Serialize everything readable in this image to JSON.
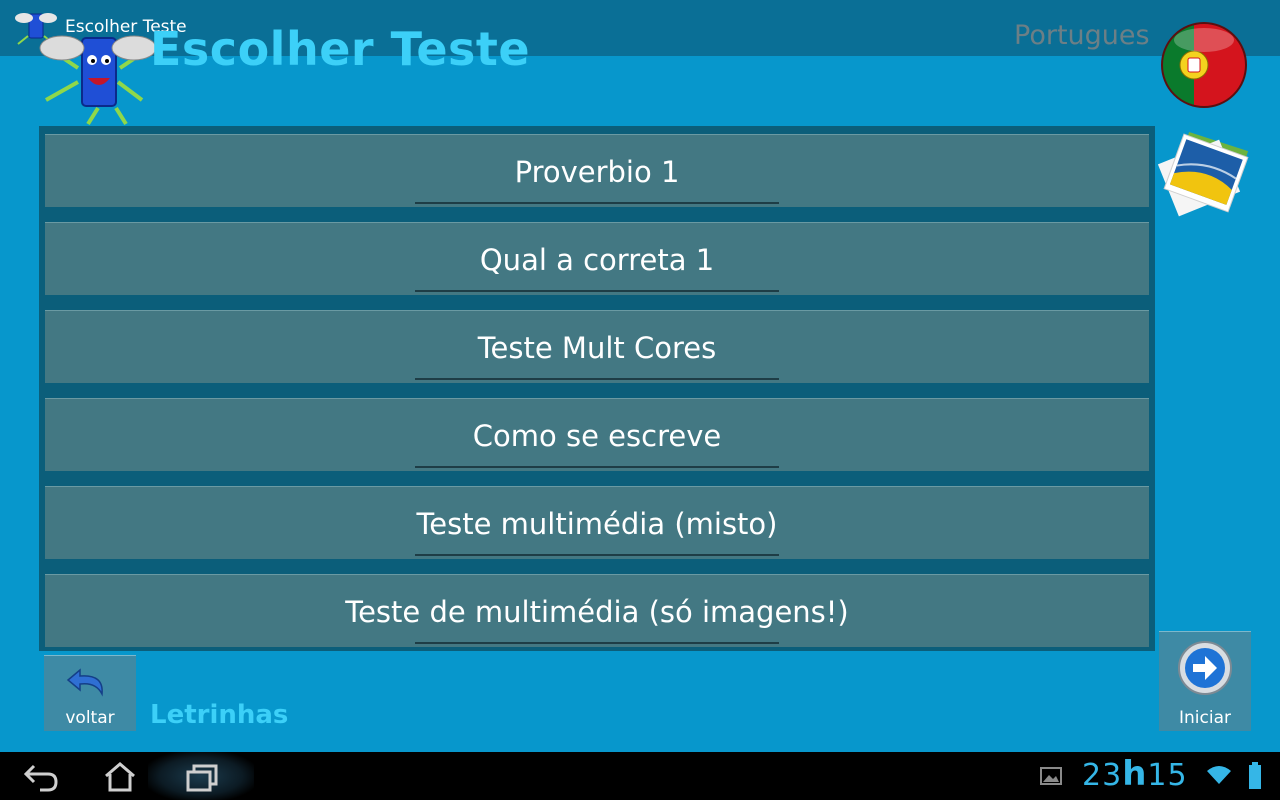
{
  "app": {
    "window_title": "Escolher Teste",
    "page_title": "Escolher Teste",
    "language": "Portugues"
  },
  "tests": [
    {
      "label": "Proverbio 1"
    },
    {
      "label": "Qual a correta 1"
    },
    {
      "label": "Teste Mult Cores"
    },
    {
      "label": "Como se escreve"
    },
    {
      "label": "Teste multimédia (misto)"
    },
    {
      "label": "Teste de multimédia (só imagens!)"
    }
  ],
  "footer": {
    "back_label": "voltar",
    "app_name": "Letrinhas",
    "start_label": "Iniciar"
  },
  "statusbar": {
    "hour": "23",
    "hour_sep": "h",
    "minute": "15"
  },
  "colors": {
    "background": "#0797cc",
    "title_accent": "#3cd0f8",
    "list_item": "#437883",
    "list_frame": "#0b5e7a",
    "clock": "#35b6e7"
  }
}
